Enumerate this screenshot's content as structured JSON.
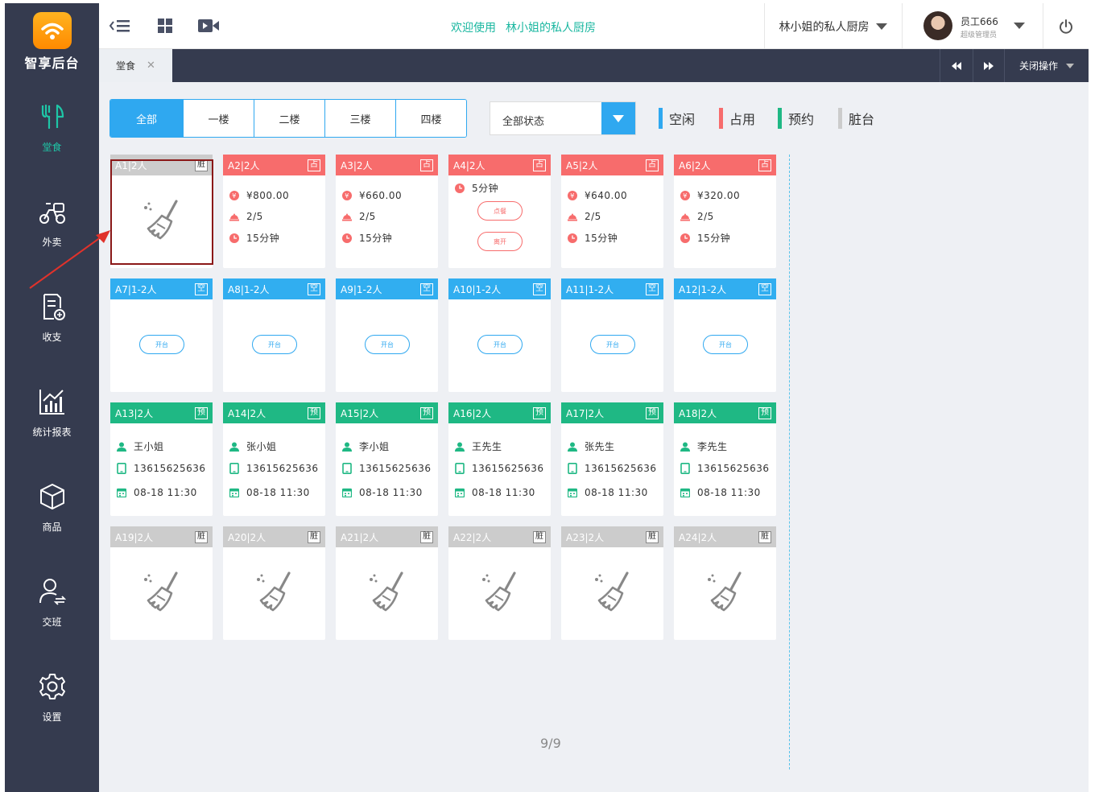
{
  "brand": {
    "name": "智享后台"
  },
  "sidebar": {
    "items": [
      {
        "label": "堂食",
        "icon": "utensils-icon",
        "active": true
      },
      {
        "label": "外卖",
        "icon": "scooter-icon",
        "active": false
      },
      {
        "label": "收支",
        "icon": "finance-doc-icon",
        "active": false
      },
      {
        "label": "统计报表",
        "icon": "chart-icon",
        "active": false
      },
      {
        "label": "商品",
        "icon": "cube-icon",
        "active": false
      },
      {
        "label": "交班",
        "icon": "user-switch-icon",
        "active": false
      },
      {
        "label": "设置",
        "icon": "gear-icon",
        "active": false
      }
    ]
  },
  "header": {
    "welcome_prefix": "欢迎使用",
    "welcome_shop": "林小姐的私人厨房",
    "shop_select": "林小姐的私人厨房",
    "user_name": "员工666",
    "user_role": "超级管理员"
  },
  "tabbar": {
    "current_tab": "堂食",
    "close_ops": "关闭操作"
  },
  "floors": [
    "全部",
    "一楼",
    "二楼",
    "三楼",
    "四楼"
  ],
  "active_floor": "全部",
  "status_filter": "全部状态",
  "legend": [
    {
      "label": "空闲",
      "color": "#2fa8f0"
    },
    {
      "label": "占用",
      "color": "#f76c6c"
    },
    {
      "label": "预约",
      "color": "#1fb884"
    },
    {
      "label": "脏台",
      "color": "#cccccc"
    }
  ],
  "colors": {
    "free": "#31aef0",
    "occupied": "#f76c6c",
    "reserved": "#1fb884",
    "dirty": "#cccccc",
    "accent": "#1ab7a0"
  },
  "tables": [
    {
      "name": "A1|2人",
      "status": "dirty",
      "badge": "脏"
    },
    {
      "name": "A2|2人",
      "status": "occupied",
      "badge": "占",
      "amount": "¥800.00",
      "guests": "2/5",
      "time": "15分钟"
    },
    {
      "name": "A3|2人",
      "status": "occupied",
      "badge": "占",
      "amount": "¥660.00",
      "guests": "2/5",
      "time": "15分钟"
    },
    {
      "name": "A4|2人",
      "status": "occupied_new",
      "badge": "占",
      "time": "5分钟",
      "btn1": "点餐",
      "btn2": "离开"
    },
    {
      "name": "A5|2人",
      "status": "occupied",
      "badge": "占",
      "amount": "¥640.00",
      "guests": "2/5",
      "time": "15分钟"
    },
    {
      "name": "A6|2人",
      "status": "occupied",
      "badge": "占",
      "amount": "¥320.00",
      "guests": "2/5",
      "time": "15分钟"
    },
    {
      "name": "A7|1-2人",
      "status": "free",
      "badge": "空",
      "btn": "开台"
    },
    {
      "name": "A8|1-2人",
      "status": "free",
      "badge": "空",
      "btn": "开台"
    },
    {
      "name": "A9|1-2人",
      "status": "free",
      "badge": "空",
      "btn": "开台"
    },
    {
      "name": "A10|1-2人",
      "status": "free",
      "badge": "空",
      "btn": "开台"
    },
    {
      "name": "A11|1-2人",
      "status": "free",
      "badge": "空",
      "btn": "开台"
    },
    {
      "name": "A12|1-2人",
      "status": "free",
      "badge": "空",
      "btn": "开台"
    },
    {
      "name": "A13|2人",
      "status": "reserved",
      "badge": "预",
      "person": "王小姐",
      "phone": "13615625636",
      "datetime": "08-18 11:30"
    },
    {
      "name": "A14|2人",
      "status": "reserved",
      "badge": "预",
      "person": "张小姐",
      "phone": "13615625636",
      "datetime": "08-18 11:30"
    },
    {
      "name": "A15|2人",
      "status": "reserved",
      "badge": "预",
      "person": "李小姐",
      "phone": "13615625636",
      "datetime": "08-18 11:30"
    },
    {
      "name": "A16|2人",
      "status": "reserved",
      "badge": "预",
      "person": "王先生",
      "phone": "13615625636",
      "datetime": "08-18 11:30"
    },
    {
      "name": "A17|2人",
      "status": "reserved",
      "badge": "预",
      "person": "张先生",
      "phone": "13615625636",
      "datetime": "08-18 11:30"
    },
    {
      "name": "A18|2人",
      "status": "reserved",
      "badge": "预",
      "person": "李先生",
      "phone": "13615625636",
      "datetime": "08-18 11:30"
    },
    {
      "name": "A19|2人",
      "status": "dirty",
      "badge": "脏"
    },
    {
      "name": "A20|2人",
      "status": "dirty",
      "badge": "脏"
    },
    {
      "name": "A21|2人",
      "status": "dirty",
      "badge": "脏"
    },
    {
      "name": "A22|2人",
      "status": "dirty",
      "badge": "脏"
    },
    {
      "name": "A23|2人",
      "status": "dirty",
      "badge": "脏"
    },
    {
      "name": "A24|2人",
      "status": "dirty",
      "badge": "脏"
    }
  ],
  "pager": "9/9"
}
